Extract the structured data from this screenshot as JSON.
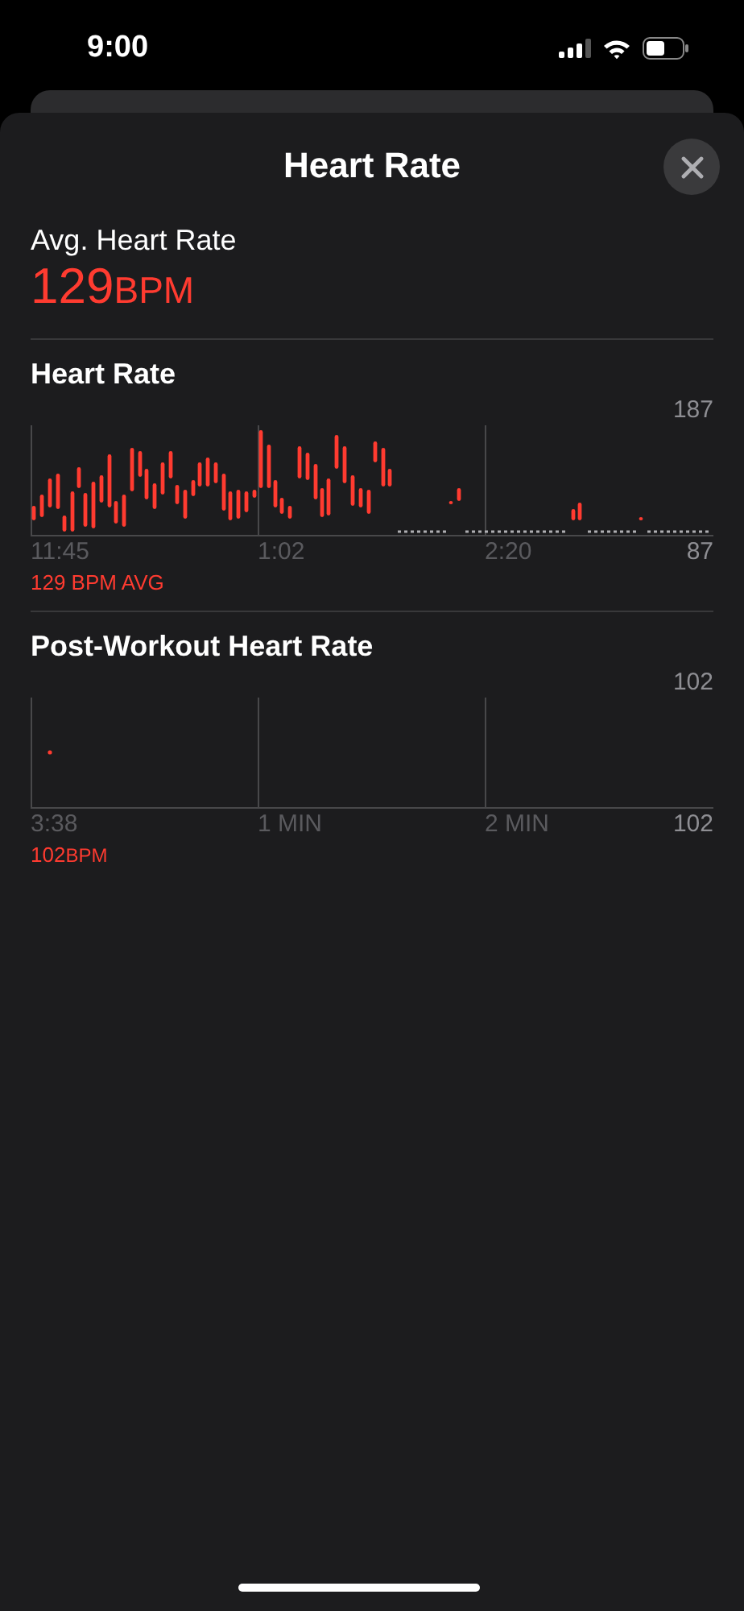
{
  "status_bar": {
    "time": "9:00"
  },
  "sheet": {
    "title": "Heart Rate"
  },
  "summary": {
    "label": "Avg. Heart Rate",
    "value": "129",
    "unit": "BPM"
  },
  "sections": [
    {
      "kind": "range",
      "title": "Heart Rate",
      "y_max": "187",
      "x_labels": [
        "11:45",
        "1:02",
        "2:20"
      ],
      "y_min": "87",
      "footer": {
        "value": "129 BPM AVG"
      }
    },
    {
      "kind": "point",
      "title": "Post-Workout Heart Rate",
      "y_max": "102",
      "x_labels": [
        "3:38",
        "1 MIN",
        "2 MIN"
      ],
      "y_min": "102",
      "footer": {
        "value": "102",
        "unit": "BPM"
      }
    }
  ]
}
